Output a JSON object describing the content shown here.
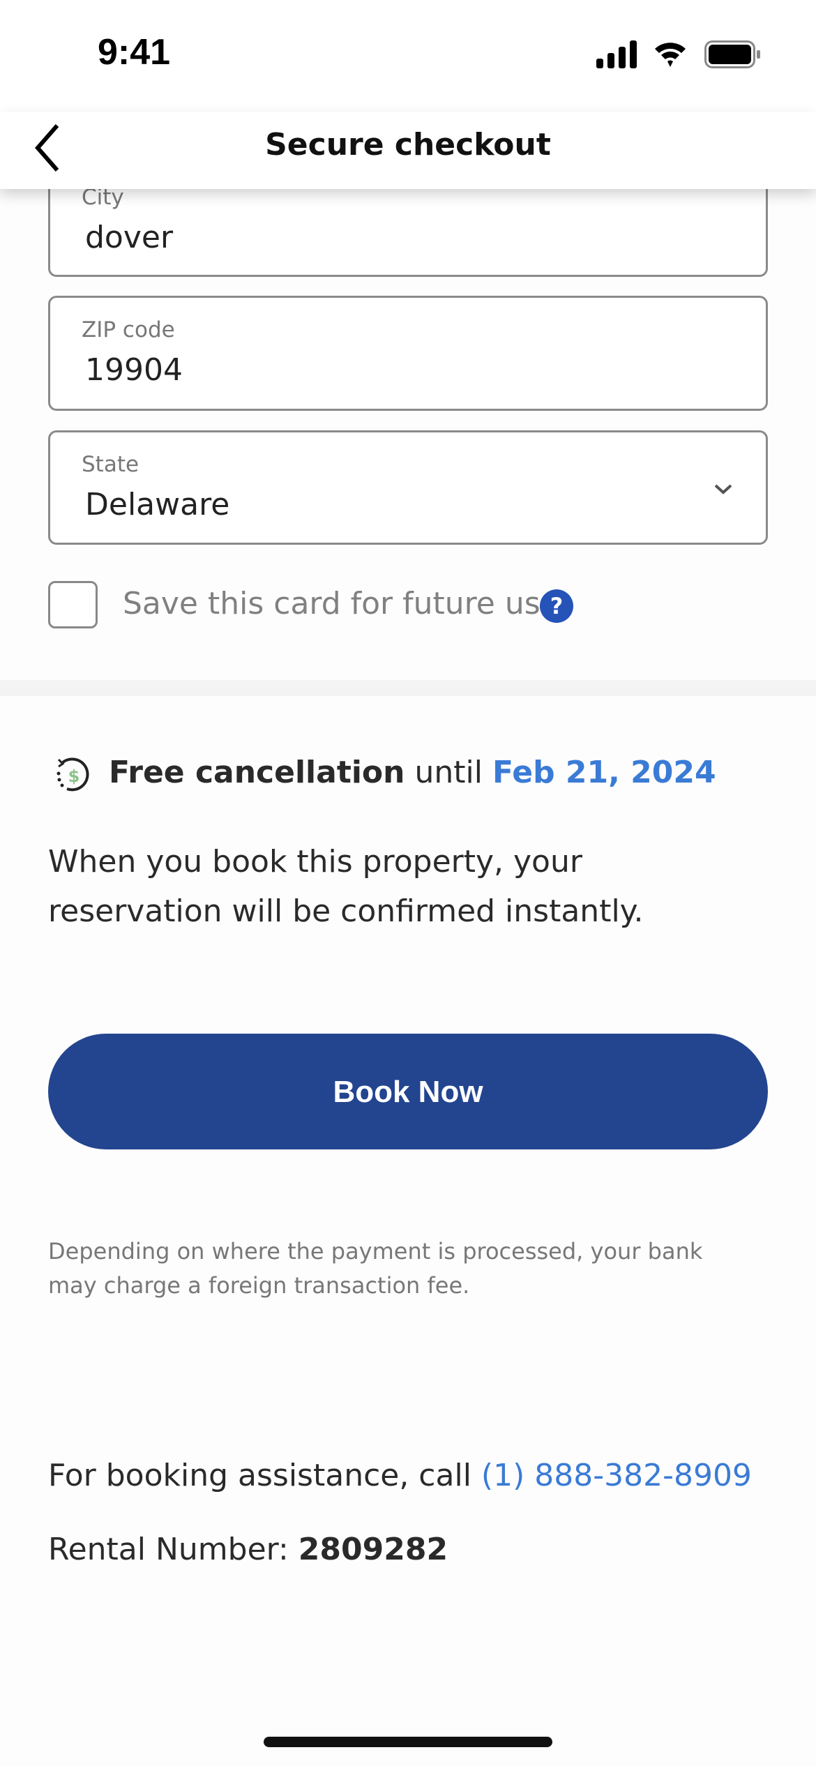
{
  "status_bar": {
    "time": "9:41",
    "icons": [
      "signal-icon",
      "wifi-icon",
      "battery-icon"
    ]
  },
  "header": {
    "title": "Secure checkout",
    "back_icon": "chevron-left-icon"
  },
  "form": {
    "city": {
      "label": "City",
      "value": "dover"
    },
    "zip": {
      "label": "ZIP code",
      "value": "19904"
    },
    "state": {
      "label": "State",
      "value": "Delaware"
    },
    "save_card": {
      "label": "Save this card for future use",
      "checked": false,
      "help": "?"
    }
  },
  "cancellation": {
    "bold": "Free cancellation",
    "middle": "until",
    "date": "Feb 21, 2024",
    "icon": "refund-clock-icon"
  },
  "confirmation_text": "When you book this property, your reservation will be confirmed instantly.",
  "book_button": "Book Now",
  "fee_notice": "Depending on where the payment is processed, your bank may charge a foreign transaction fee.",
  "assistance": {
    "text": "For booking assistance, call",
    "phone": "(1) 888-382-8909"
  },
  "rental": {
    "label": "Rental Number:",
    "number": "2809282"
  },
  "colors": {
    "primary": "#234590",
    "link": "#3a7bd5",
    "help": "#2553b8"
  }
}
